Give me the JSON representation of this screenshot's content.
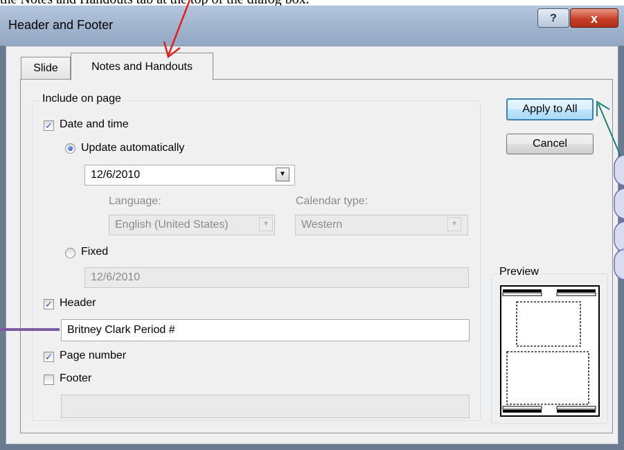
{
  "caption": "the Notes and Handouts tab at the top of the dialog box.",
  "window": {
    "title": "Header and Footer",
    "help": "?",
    "close": "x"
  },
  "tabs": [
    {
      "label": "Slide"
    },
    {
      "label": "Notes and Handouts"
    }
  ],
  "include": {
    "group_label": "Include on page",
    "date_time": {
      "label": "Date and time",
      "checked": true
    },
    "update_auto": {
      "label": "Update automatically",
      "selected": true,
      "value": "12/6/2010"
    },
    "language": {
      "label": "Language:",
      "value": "English (United States)"
    },
    "calendar": {
      "label": "Calendar type:",
      "value": "Western"
    },
    "fixed": {
      "label": "Fixed",
      "selected": false,
      "value": "12/6/2010"
    },
    "header": {
      "label": "Header",
      "checked": true,
      "value": "Britney Clark Period #"
    },
    "page_number": {
      "label": "Page number",
      "checked": true
    },
    "footer": {
      "label": "Footer",
      "checked": false,
      "value": ""
    }
  },
  "buttons": {
    "apply": "Apply to All",
    "cancel": "Cancel"
  },
  "preview": {
    "label": "Preview"
  },
  "colors": {
    "annotation_red": "#e02020",
    "annotation_teal": "#1f7f74",
    "annotation_purple": "#7a5aa0",
    "bubble_fill": "#d9dcef",
    "bubble_stroke": "#6b6fb3"
  }
}
